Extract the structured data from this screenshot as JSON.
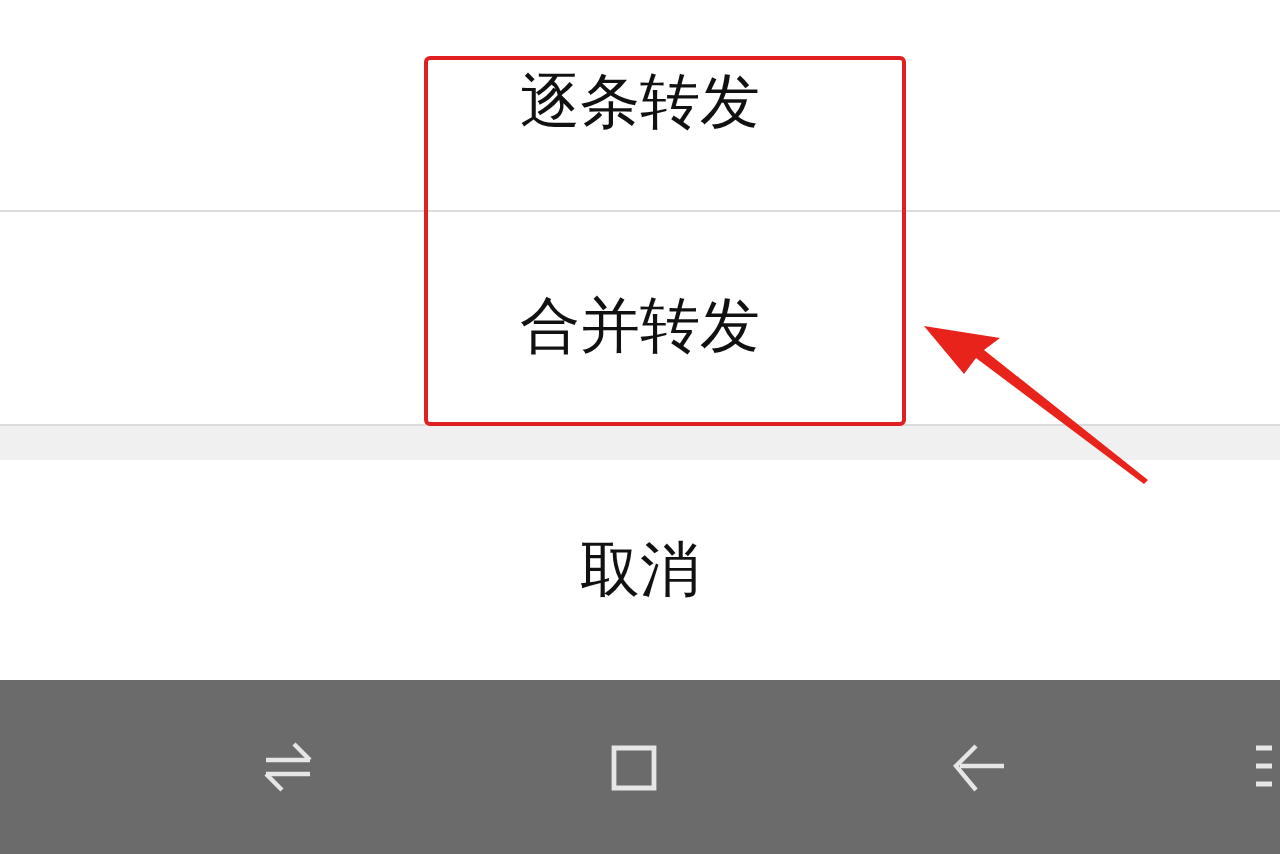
{
  "action_sheet": {
    "options": [
      {
        "label": "逐条转发",
        "selected": false
      },
      {
        "label": "合并转发",
        "selected": true
      }
    ],
    "cancel": {
      "label": "取消"
    }
  },
  "nav_bar": {
    "buttons": [
      {
        "kind": "recent"
      },
      {
        "kind": "home"
      },
      {
        "kind": "back"
      },
      {
        "kind": "menu"
      }
    ]
  }
}
